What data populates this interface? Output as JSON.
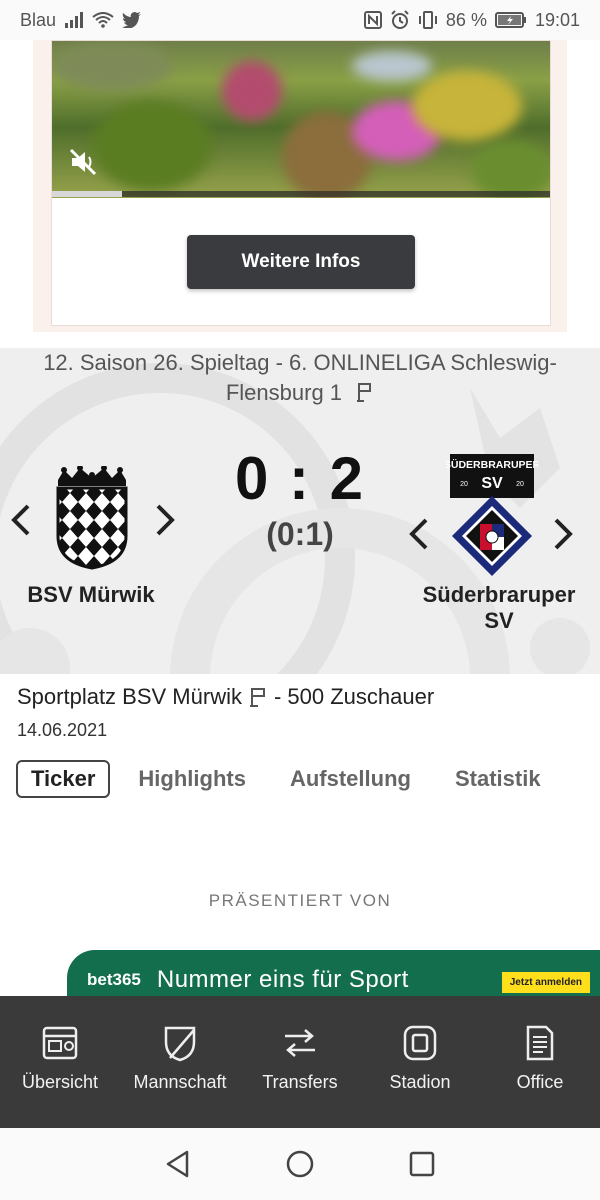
{
  "status_bar": {
    "carrier": "Blau",
    "battery": "86 %",
    "time": "19:01"
  },
  "ad": {
    "button_label": "Weitere Infos",
    "progress_fraction": 0.14
  },
  "match": {
    "competition": "12. Saison 26. Spieltag - 6. ONLINELIGA Schleswig-Flensburg 1",
    "home_team": "BSV Mürwik",
    "away_team": "Süderbraruper SV",
    "away_crest_text_top": "SÜDERBRARUPER",
    "away_crest_text_mid": "SV",
    "away_crest_year_left": "20",
    "away_crest_year_right": "20",
    "score": "0 : 2",
    "halftime": "(0:1)"
  },
  "venue": {
    "place": "Sportplatz BSV Mürwik",
    "spectators": "- 500 Zuschauer",
    "date": "14.06.2021"
  },
  "tabs": [
    "Ticker",
    "Highlights",
    "Aufstellung",
    "Statistik"
  ],
  "presented_by": "PRÄSENTIERT VON",
  "banner": {
    "logo": "bet365",
    "slogan": "Nummer eins für Sport",
    "cta": "Jetzt anmelden"
  },
  "bottom_nav": [
    "Übersicht",
    "Mannschaft",
    "Transfers",
    "Stadion",
    "Office"
  ],
  "colors": {
    "nav_bg": "#3a3a3a",
    "banner_green": "#136e4e",
    "banner_cta": "#ffdf1b",
    "button_bg": "#3a3b3e"
  }
}
